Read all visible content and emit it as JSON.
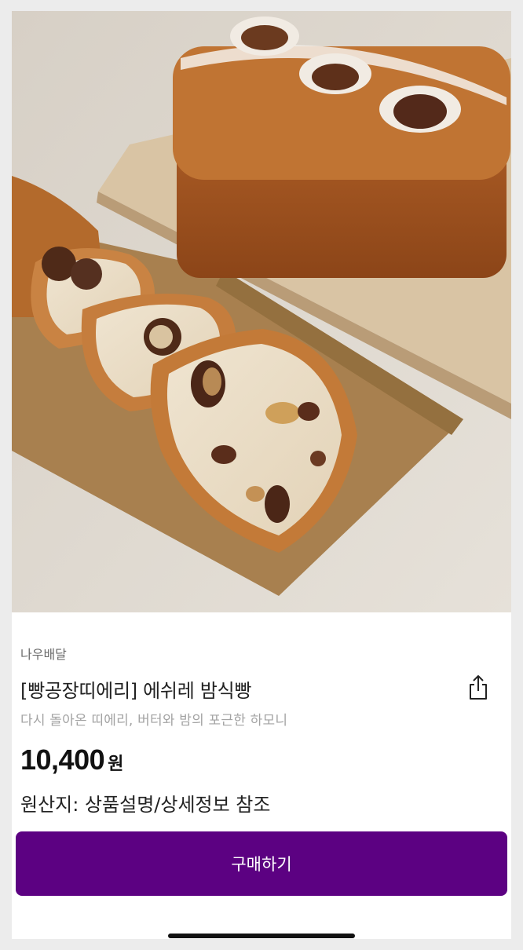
{
  "product": {
    "image_alt": "에쉬레 밤식빵",
    "seller": "나우배달",
    "title": "[빵공장띠에리] 에쉬레 밤식빵",
    "subtitle": "다시 돌아온 띠에리, 버터와 밤의 포근한 하모니",
    "price": "10,400",
    "price_unit": "원",
    "origin": "원산지: 상품설명/상세정보 참조"
  },
  "actions": {
    "buy_label": "구매하기",
    "share_icon": "share-icon"
  },
  "colors": {
    "accent": "#5c0182",
    "text": "#222222",
    "muted": "#a3a3a3"
  }
}
